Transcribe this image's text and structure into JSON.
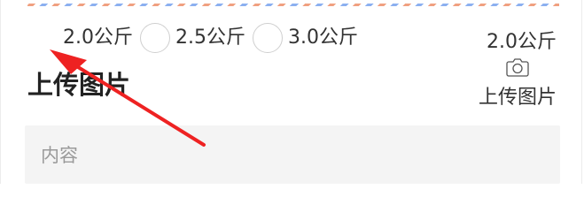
{
  "weights": {
    "options": [
      "2.0公斤",
      "2.5公斤",
      "3.0公斤"
    ]
  },
  "right_panel": {
    "selected_weight": "2.0公斤",
    "upload_label": "上传图片",
    "camera_icon": "camera-icon"
  },
  "upload_section": {
    "title": "上传图片"
  },
  "content_field": {
    "placeholder": "内容"
  },
  "annotation": {
    "arrow_color": "#ee2222"
  }
}
